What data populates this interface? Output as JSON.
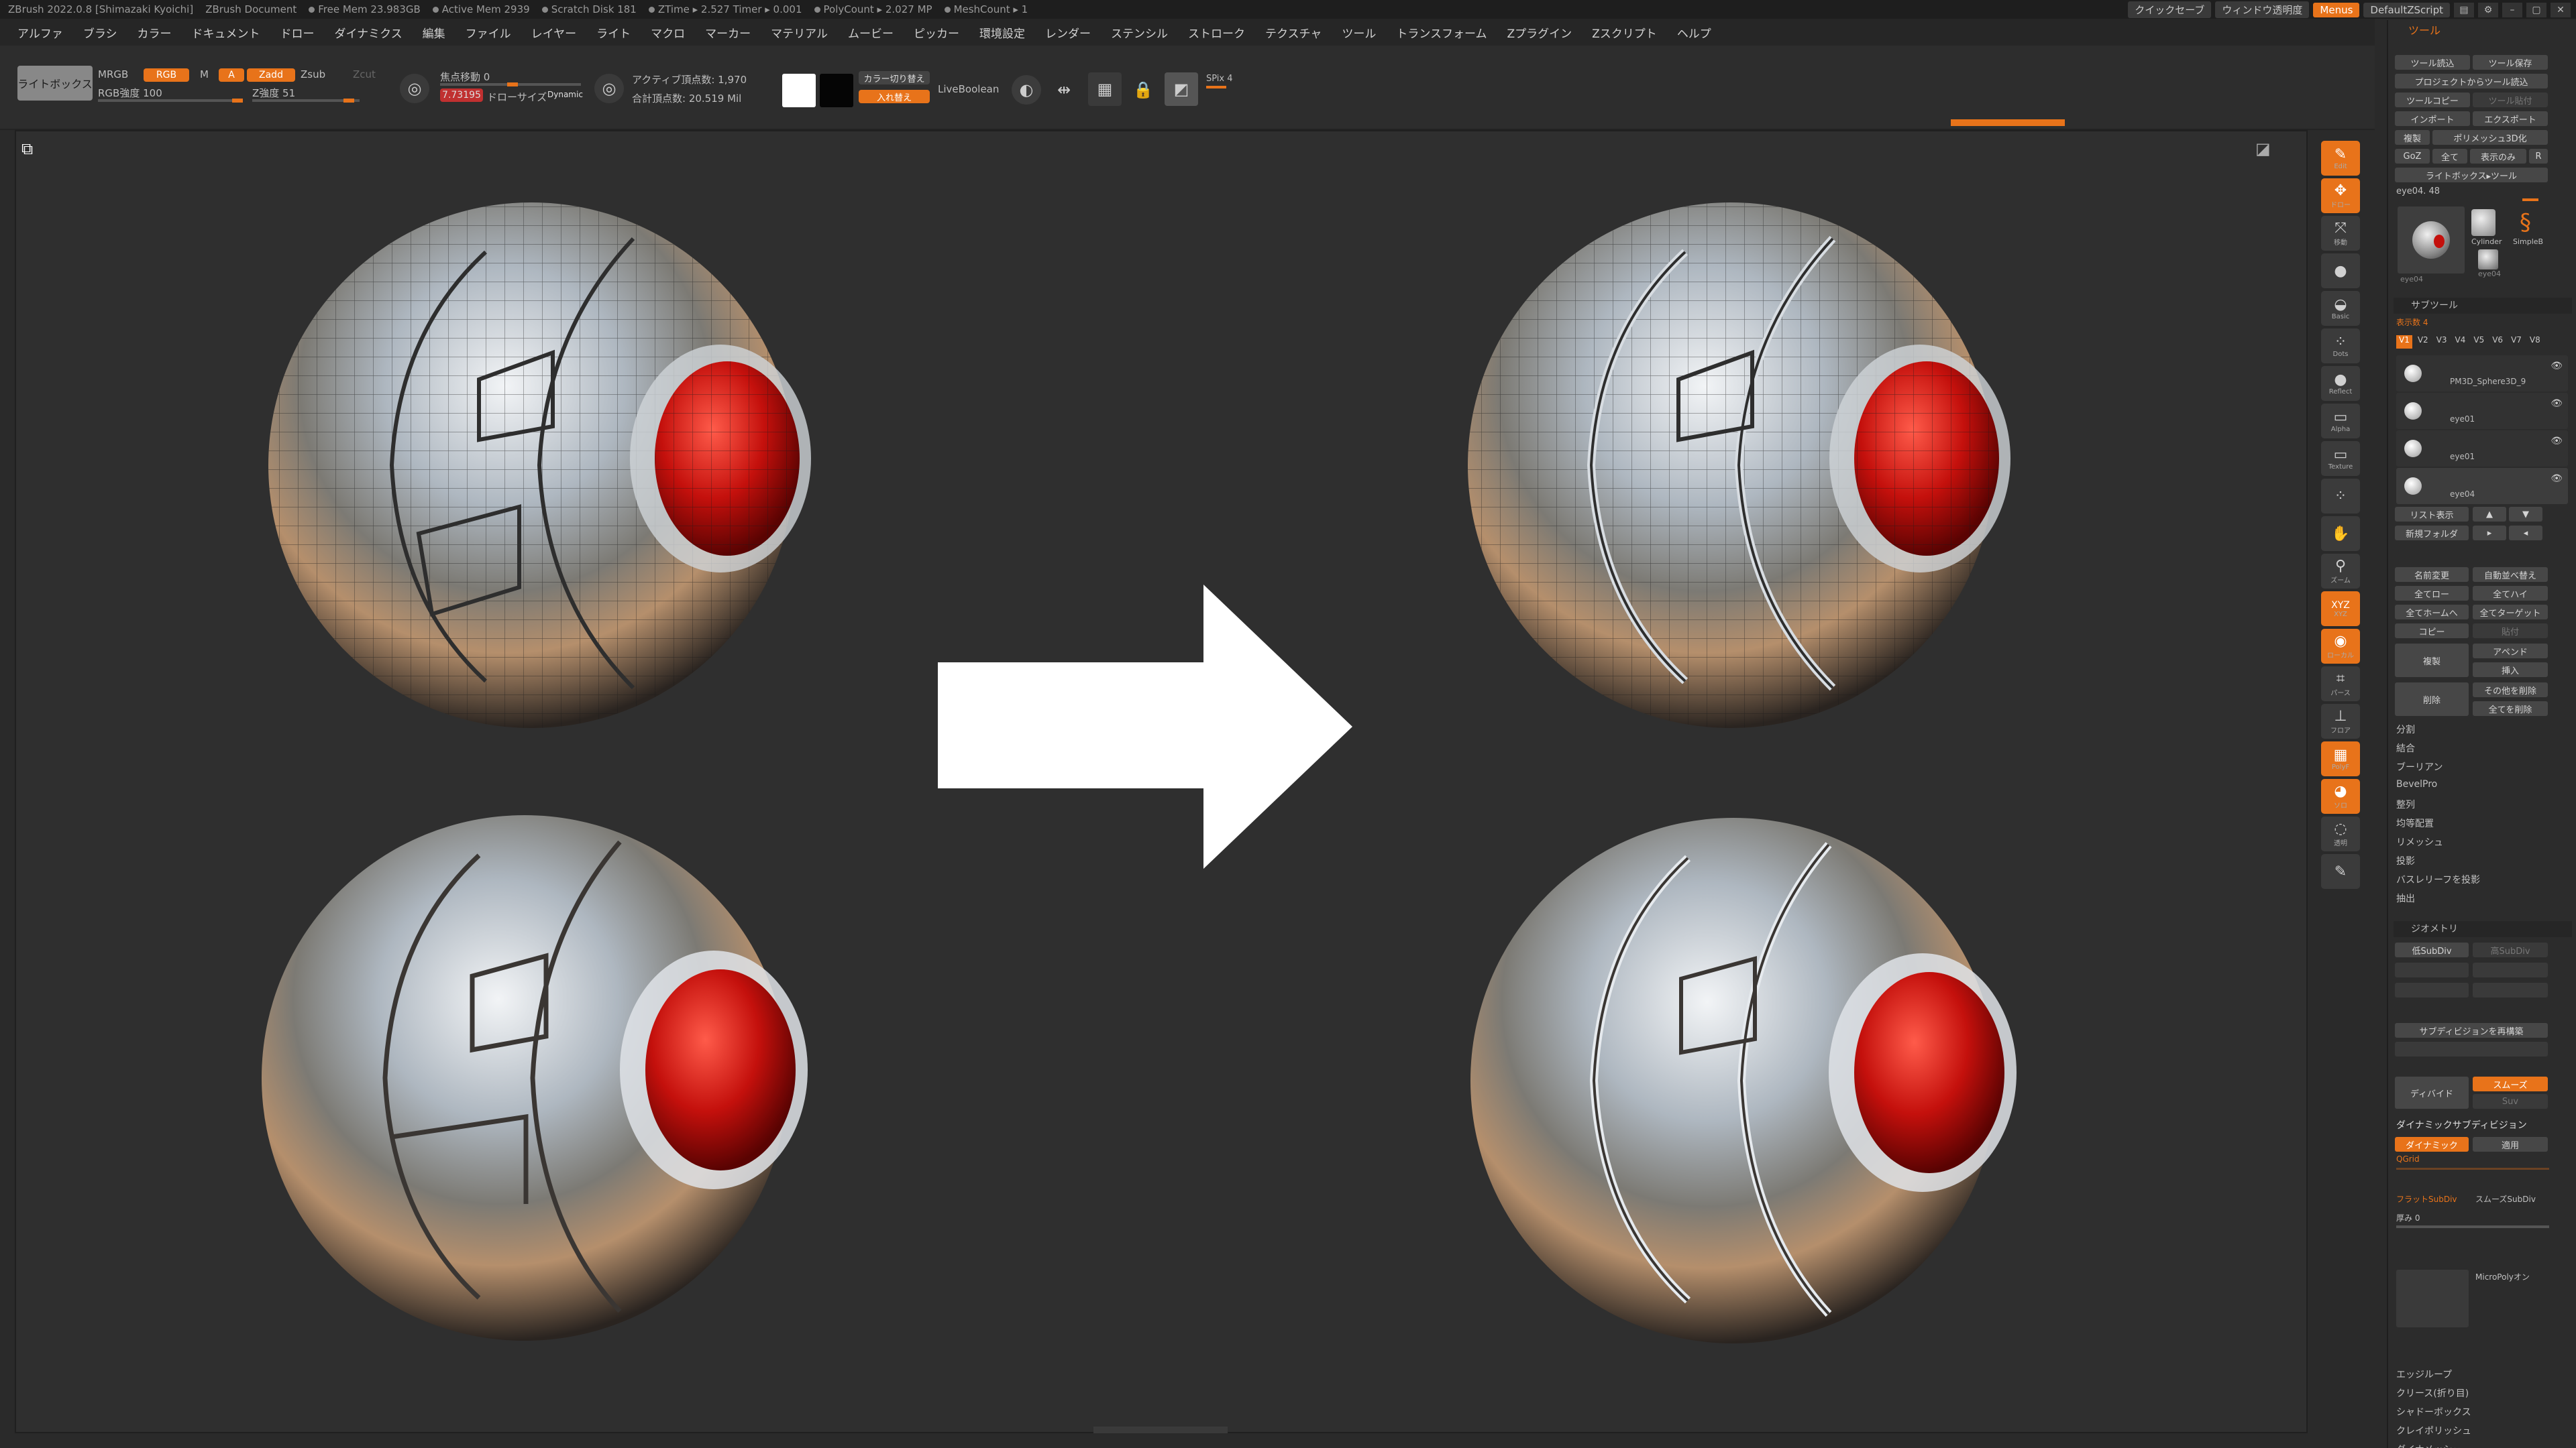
{
  "titlebar": {
    "app": "ZBrush 2022.0.8 [Shimazaki Kyoichi]",
    "doc": "ZBrush Document",
    "stats": [
      "Free Mem 23.983GB",
      "Active Mem 2939",
      "Scratch Disk 181",
      "ZTime ▸ 2.527 Timer ▸ 0.001",
      "PolyCount ▸ 2.027 MP",
      "MeshCount ▸ 1"
    ],
    "quicksave": "クイックセーブ",
    "transparency": "ウィンドウ透明度",
    "menus": "Menus",
    "zscript": "DefaultZScript"
  },
  "menubar": [
    "アルファ",
    "ブラシ",
    "カラー",
    "ドキュメント",
    "ドロー",
    "ダイナミクス",
    "編集",
    "ファイル",
    "レイヤー",
    "ライト",
    "マクロ",
    "マーカー",
    "マテリアル",
    "ムービー",
    "ピッカー",
    "環境設定",
    "レンダー",
    "ステンシル",
    "ストローク",
    "テクスチャ",
    "ツール",
    "トランスフォーム",
    "Zプラグイン",
    "Zスクリプト",
    "ヘルプ"
  ],
  "toolbar": {
    "lightbox": "ライトボックス",
    "mrgb": "MRGB",
    "rgb": "RGB",
    "m": "M",
    "zadd": "Zadd",
    "zsub": "Zsub",
    "zcut": "Zcut",
    "a": "A",
    "rgb_intensity": "RGB強度 100",
    "z_intensity": "Z強度 51",
    "focal_shift": "焦点移動 0",
    "draw_size_value": "7.73195",
    "draw_size": "ドローサイズ",
    "dynamic": "Dynamic",
    "active_points": "アクティブ頂点数: 1,970",
    "total_points": "合計頂点数: 20.519 Mil",
    "color_switch": "カラー切り替え",
    "swap": "入れ替え",
    "live_boolean": "LiveBoolean",
    "spix": "SPix 4"
  },
  "canvas": {
    "ratio_icon": "frame-icon"
  },
  "shelf": [
    {
      "label": "Edit",
      "orange": true
    },
    {
      "label": "ドロー",
      "orange": true
    },
    {
      "label": "移動",
      "orange": false
    },
    {
      "label": "",
      "orange": false
    },
    {
      "label": "Basic",
      "orange": false
    },
    {
      "label": "Dots",
      "orange": false
    },
    {
      "label": "Reflect",
      "orange": false
    },
    {
      "label": "Alpha",
      "orange": false
    },
    {
      "label": "Texture",
      "orange": false
    },
    {
      "label": "",
      "orange": false
    },
    {
      "label": "",
      "orange": false
    },
    {
      "label": "ズーム",
      "orange": false
    },
    {
      "label": "XYZ",
      "orange": true
    },
    {
      "label": "ローカル",
      "orange": true
    },
    {
      "label": "パース",
      "orange": false
    },
    {
      "label": "フロア",
      "orange": false
    },
    {
      "label": "PolyF",
      "orange": true
    },
    {
      "label": "ソロ",
      "orange": true
    },
    {
      "label": "透明",
      "orange": false
    },
    {
      "label": "",
      "orange": false
    }
  ],
  "toolpanel": {
    "title": "ツール",
    "load": "ツール読込",
    "save": "ツール保存",
    "load_from_project": "プロジェクトからツール読込",
    "copy_tool": "ツールコピー",
    "paste_tool": "ツール貼付",
    "import": "インポート",
    "export": "エクスポート",
    "clone": "複製",
    "make_polymesh": "ポリメッシュ3D化",
    "goz": "GoZ",
    "all": "全て",
    "visible_only": "表示のみ",
    "r": "R",
    "lightbox_tools": "ライトボックス▸ツール",
    "tool_name": "eye04. 48",
    "thumbs": [
      "eye04",
      "Cylinder",
      "SimpleB",
      "eye04"
    ],
    "subtool_header": "サブツール",
    "visible_count": "表示数 4",
    "versions": [
      "V1",
      "V2",
      "V3",
      "V4",
      "V5",
      "V6",
      "V7",
      "V8"
    ],
    "subtools": [
      "PM3D_Sphere3D_9",
      "eye01",
      "eye01",
      "eye04"
    ],
    "list_view": "リスト表示",
    "new_folder": "新規フォルダ",
    "rename": "名前変更",
    "auto_reorder": "自動並べ替え",
    "all_low": "全てロー",
    "all_high": "全てハイ",
    "all_to_home": "全てホームへ",
    "all_to_target": "全てターゲット",
    "copy": "コピー",
    "paste": "貼付",
    "duplicate": "複製",
    "append": "アペンド",
    "insert": "挿入",
    "delete": "削除",
    "del_other": "その他を削除",
    "del_all": "全てを削除",
    "split": "分割",
    "merge": "結合",
    "boolean": "ブーリアン",
    "bevelpro": "BevelPro",
    "align": "整列",
    "distribute": "均等配置",
    "remesh": "リメッシュ",
    "project": "投影",
    "project_bas": "バスレリーフを投影",
    "extract": "抽出",
    "geometry_header": "ジオメトリ",
    "lower_subdiv": "低SubDiv",
    "higher_subdiv": "高SubDiv",
    "reconstruct": "サブディビジョンを再構築",
    "divide": "ディバイド",
    "smooth": "スムーズ",
    "suv": "Suv",
    "dynamic_subdiv": "ダイナミックサブディビジョン",
    "dynamic": "ダイナミック",
    "apply": "適用",
    "qgrid": "QGrid",
    "flat_subdiv": "フラットSubDiv",
    "smooth_subdiv": "スムーズSubDiv",
    "thickness": "厚み 0",
    "micropoly": "MicroPolyオン",
    "edgeloop": "エッジループ",
    "crease": "クリース(折り目)",
    "shadowbox": "シャドーボックス",
    "claypolish": "クレイポリッシュ",
    "dynamesh": "ダイナメッシュ"
  }
}
